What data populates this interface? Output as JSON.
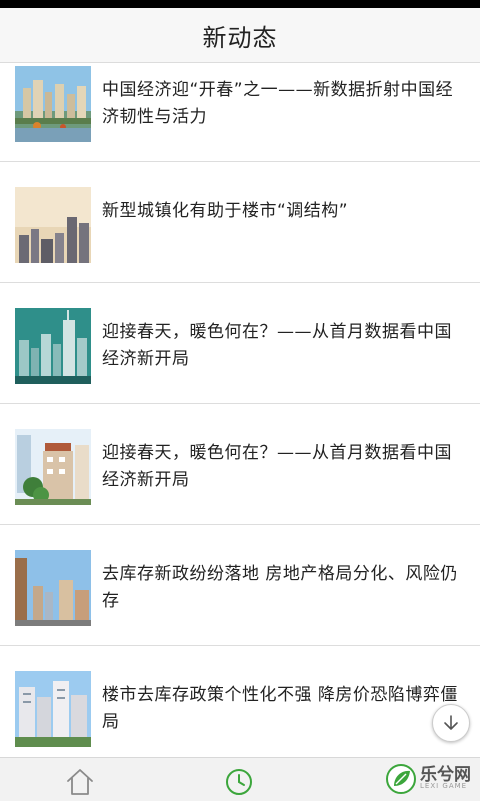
{
  "header": {
    "title": "新动态"
  },
  "news": [
    {
      "title": "中国经济迎“开春”之一——新数据折射中国经济韧性与活力",
      "image": "city-lake-skyline"
    },
    {
      "title": "新型城镇化有助于楼市“调结构”",
      "image": "city-towers-sunset"
    },
    {
      "title": "迎接春天，暖色何在？——从首月数据看中国经济新开局",
      "image": "city-skyline-teal"
    },
    {
      "title": "迎接春天，暖色何在？——从首月数据看中国经济新开局",
      "image": "residential-buildings-trees"
    },
    {
      "title": "去库存新政纷纷落地 房地产格局分化、风险仍存",
      "image": "highrise-blue-sky"
    },
    {
      "title": "楼市去库存政策个性化不强 降房价恐陷博弈僵局",
      "image": "apartment-complex"
    }
  ],
  "tabbar": {
    "items": [
      {
        "icon": "home-icon",
        "active": false
      },
      {
        "icon": "clock-icon",
        "active": true
      }
    ]
  },
  "watermark": {
    "text": "乐兮网",
    "sub": "LEXI GAME"
  },
  "colors": {
    "accent": "#3ca63c",
    "text": "#222222",
    "divider": "#dddddd"
  }
}
